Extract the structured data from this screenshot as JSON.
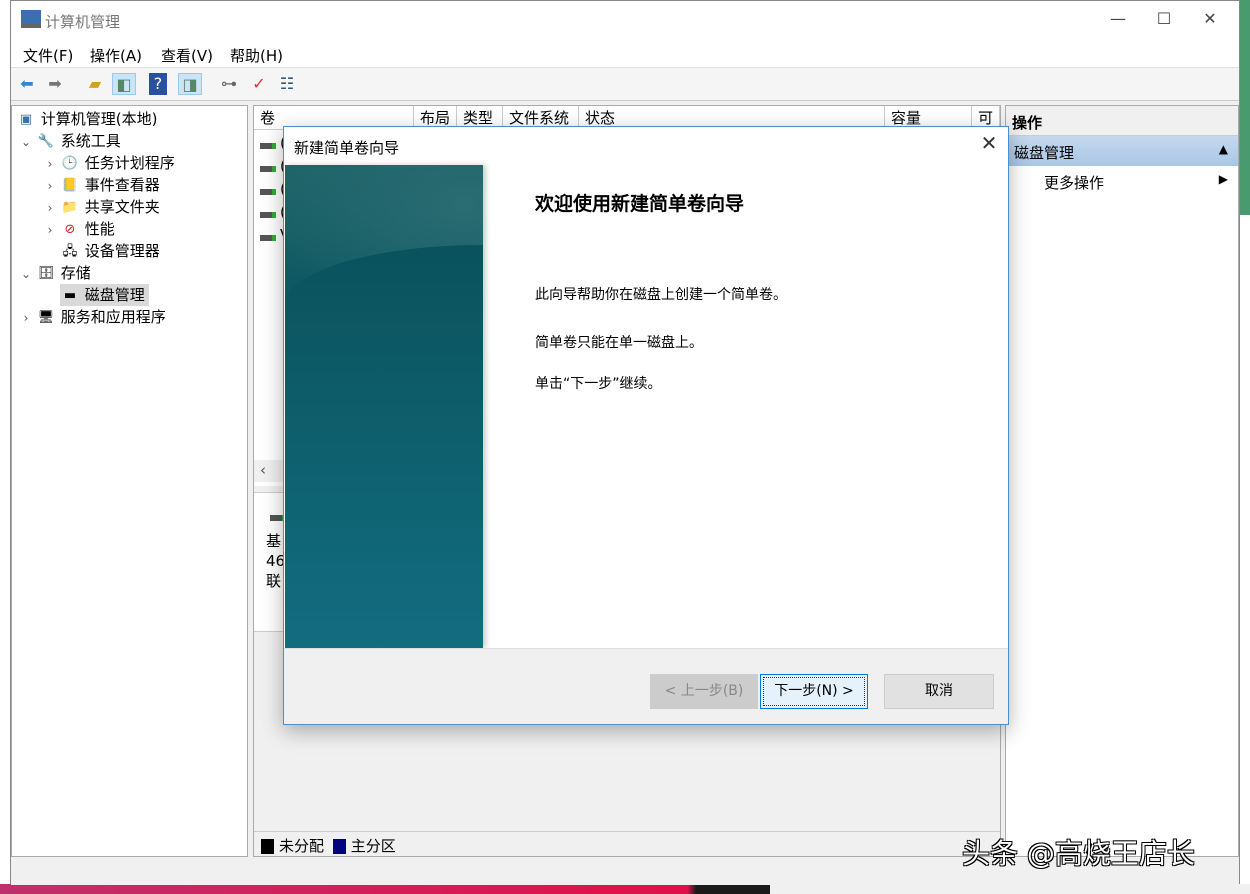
{
  "window": {
    "title": "计算机管理",
    "minimize": "—",
    "maximize": "☐",
    "close": "✕"
  },
  "menu": [
    "文件(F)",
    "操作(A)",
    "查看(V)",
    "帮助(H)"
  ],
  "tree": {
    "root": "计算机管理(本地)",
    "system_tools": "系统工具",
    "task_scheduler": "任务计划程序",
    "event_viewer": "事件查看器",
    "shared_folders": "共享文件夹",
    "performance": "性能",
    "device_manager": "设备管理器",
    "storage": "存储",
    "disk_management": "磁盘管理",
    "services": "服务和应用程序"
  },
  "columns": [
    "卷",
    "布局",
    "类型",
    "文件系统",
    "状态",
    "容量",
    "可"
  ],
  "volume_rows": [
    "(",
    "(",
    "(",
    "(",
    "V"
  ],
  "disk": {
    "line1": "基",
    "line2": "46",
    "line3": "联"
  },
  "legend": {
    "unallocated": "未分配",
    "primary": "主分区",
    "unallocated_color": "#000000",
    "primary_color": "#000080"
  },
  "actions": {
    "header": "操作",
    "section": "磁盘管理",
    "more": "更多操作"
  },
  "dialog": {
    "title": "新建简单卷向导",
    "close": "✕",
    "heading": "欢迎使用新建简单卷向导",
    "p1": "此向导帮助你在磁盘上创建一个简单卷。",
    "p2": "简单卷只能在单一磁盘上。",
    "p3": "单击“下一步”继续。",
    "back": "< 上一步(B)",
    "next": "下一步(N) >",
    "cancel": "取消"
  },
  "watermark": "头条 @高烧王店长"
}
